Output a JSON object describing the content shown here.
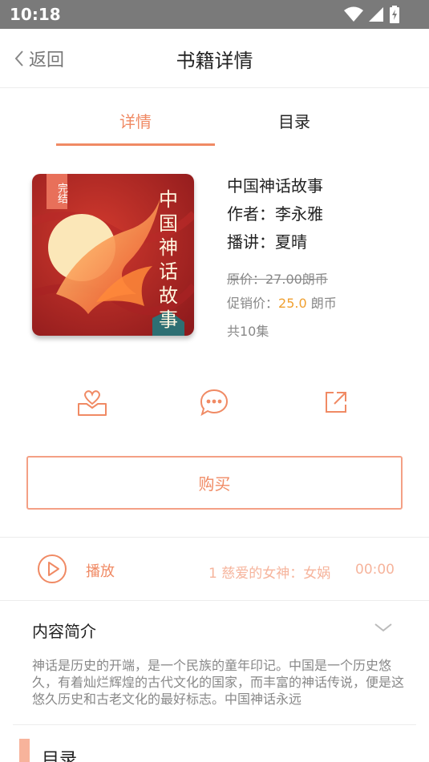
{
  "status_bar": {
    "time": "10:18"
  },
  "header": {
    "back_label": "返回",
    "title": "书籍详情"
  },
  "tabs": [
    {
      "label": "详情",
      "active": true
    },
    {
      "label": "目录",
      "active": false
    }
  ],
  "book": {
    "cover_badge": "完结",
    "title": "中国神话故事",
    "author_line": "作者：李永雅",
    "narrator_line": "播讲：夏晴",
    "original_price_line": "原价：27.00朗币",
    "promo_label": "促销价：",
    "promo_price": "25.0",
    "promo_unit": " 朗币",
    "episodes": "共10集"
  },
  "actions": [
    {
      "icon": "favorite-icon"
    },
    {
      "icon": "comment-icon"
    },
    {
      "icon": "share-icon"
    }
  ],
  "buy_label": "购买",
  "player": {
    "play_label": "播放",
    "track": "1 慈爱的女神：女娲",
    "time": "00:00"
  },
  "summary": {
    "title": "内容简介",
    "text": "神话是历史的开端，是一个民族的童年印记。中国是一个历史悠久，有着灿烂辉煌的古代文化的国家，而丰富的神话传说，便是这悠久历史和古老文化的最好标志。中国神话永远"
  },
  "catalog_section": {
    "title": "目录"
  },
  "colors": {
    "accent": "#f08a64",
    "accent_light": "#f6b49c",
    "promo_price": "#f0a030",
    "status_bar": "#7a7a7a"
  }
}
